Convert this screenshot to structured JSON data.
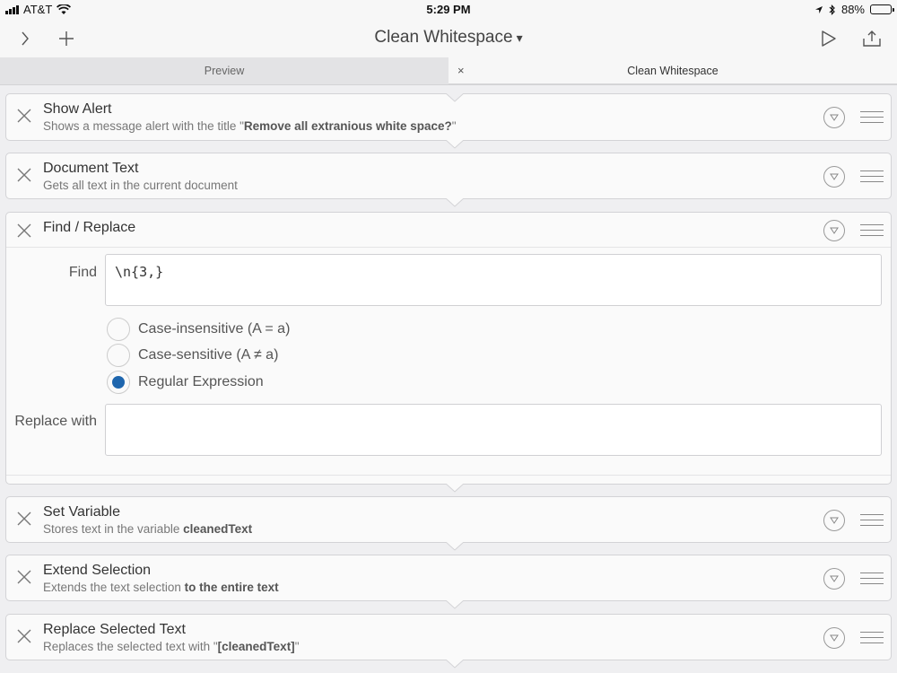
{
  "status_bar": {
    "carrier": "AT&T",
    "time": "5:29 PM",
    "battery": "88%",
    "battery_level": 0.88
  },
  "nav": {
    "title": "Clean Whitespace",
    "caret": "▾",
    "left_icons": [
      "chevron-right-icon",
      "plus-icon"
    ],
    "right_icons": [
      "play-icon",
      "share-icon"
    ]
  },
  "tabs": {
    "preview": "Preview",
    "close": "×",
    "active": "Clean Whitespace"
  },
  "actions": [
    {
      "title": "Show Alert",
      "subtitle_prefix": "Shows a message alert with the title \"",
      "subtitle_bold": "Remove all extranious white space?",
      "subtitle_suffix": "\""
    },
    {
      "title": "Document Text",
      "subtitle_prefix": "Gets all text in the current document",
      "subtitle_bold": "",
      "subtitle_suffix": ""
    },
    {
      "title": "Find / Replace"
    },
    {
      "title": "Set Variable",
      "subtitle_prefix": "Stores text in the variable ",
      "subtitle_bold": "cleanedText",
      "subtitle_suffix": ""
    },
    {
      "title": "Extend Selection",
      "subtitle_prefix": "Extends the text selection ",
      "subtitle_bold": "to the entire text",
      "subtitle_suffix": ""
    },
    {
      "title": "Replace Selected Text",
      "subtitle_prefix": "Replaces the selected text with \"",
      "subtitle_bold": "[cleanedText]",
      "subtitle_suffix": "\""
    }
  ],
  "find_replace": {
    "find_label": "Find",
    "find_value": "\\n{3,}",
    "options": [
      {
        "label": "Case-insensitive (A = a)",
        "selected": false
      },
      {
        "label": "Case-sensitive (A ≠ a)",
        "selected": false
      },
      {
        "label": "Regular Expression",
        "selected": true
      }
    ],
    "replace_label": "Replace with",
    "replace_value": ""
  },
  "colors": {
    "accent": "#1e66ae",
    "background": "#efeff1",
    "card": "#fafafa"
  }
}
